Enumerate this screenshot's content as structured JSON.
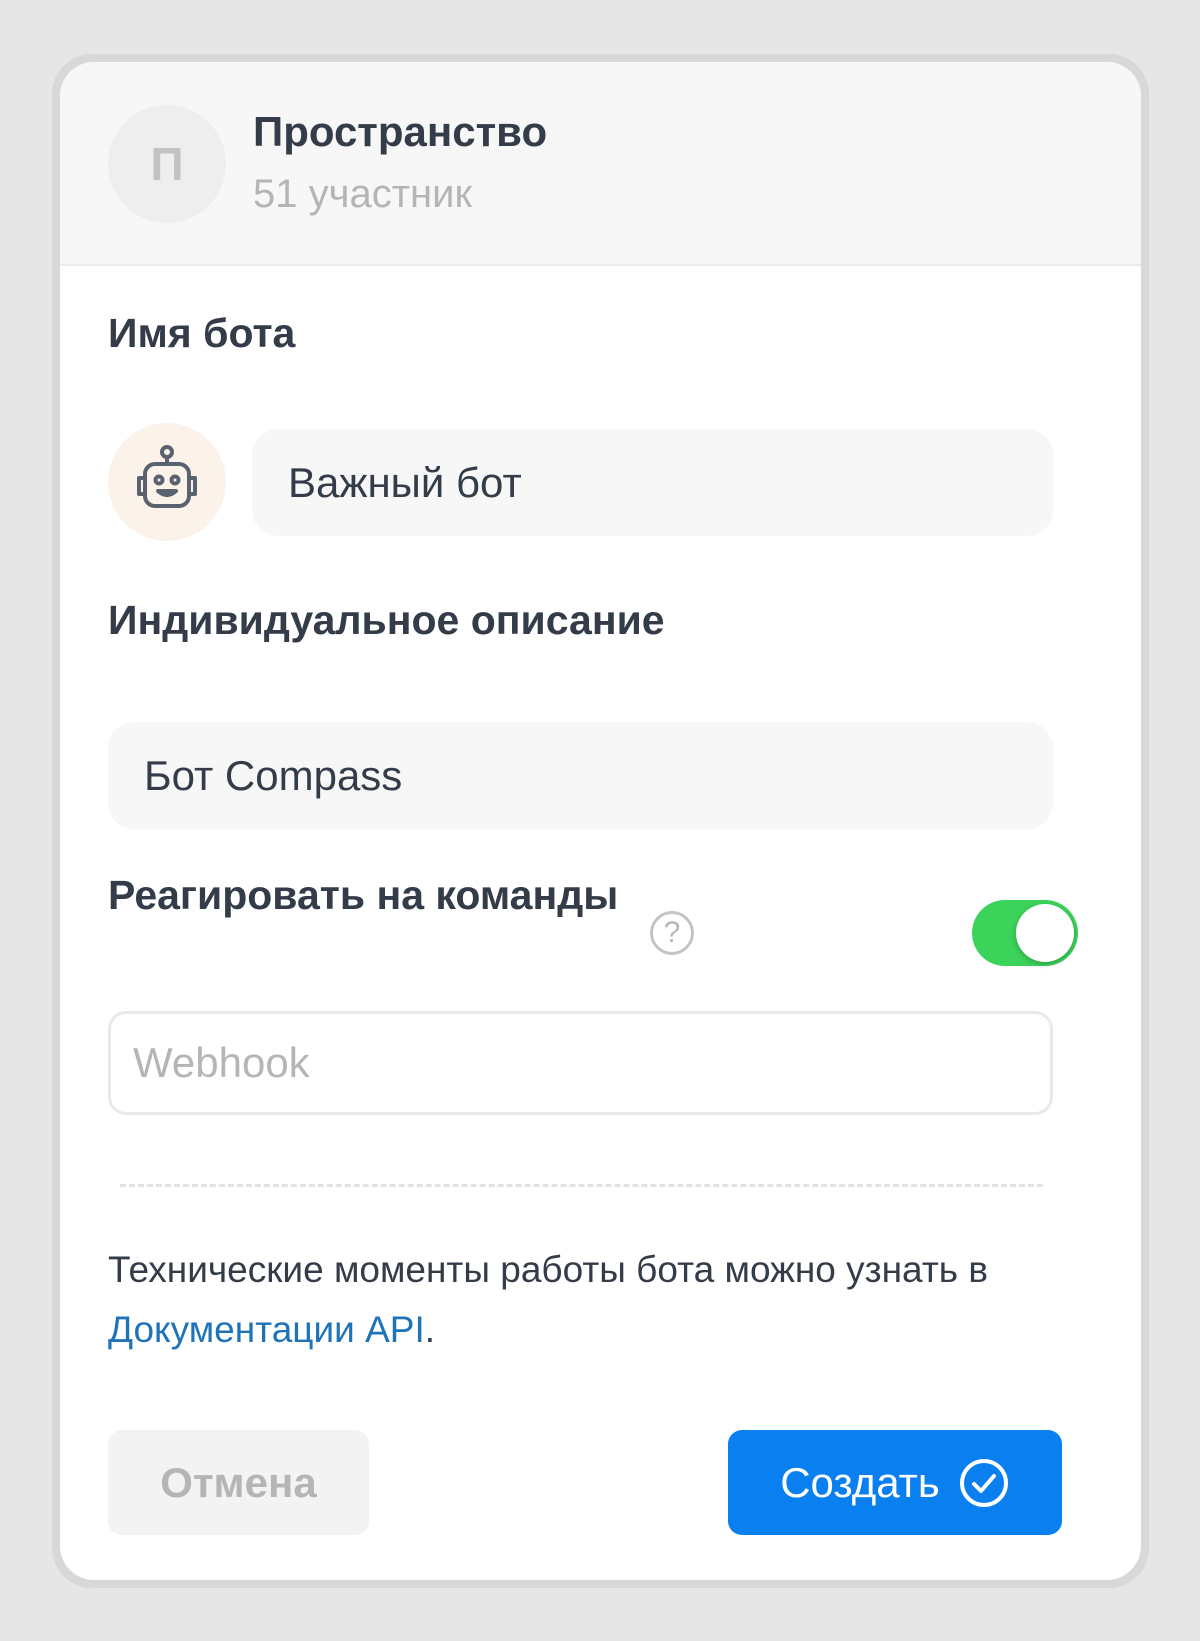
{
  "space": {
    "avatar_letter": "П",
    "title": "Пространство",
    "members": "51 участник"
  },
  "bot_name": {
    "label": "Имя бота",
    "value": "Важный бот",
    "avatar_icon": "robot-icon"
  },
  "description": {
    "label": "Индивидуальное описание",
    "value": "Бот Compass"
  },
  "commands": {
    "label": "Реагировать на команды",
    "help_icon": "question-circle-icon",
    "help_glyph": "?",
    "enabled": true,
    "toggle_color": "#3bd35a"
  },
  "webhook": {
    "placeholder": "Webhook",
    "value": ""
  },
  "note": {
    "text_before": "Технические моменты работы бота можно узнать в ",
    "link_text": "Документации API",
    "text_after": ".",
    "link_color": "#1f73b8"
  },
  "actions": {
    "cancel_label": "Отмена",
    "create_label": "Создать",
    "create_icon": "check-circle-icon",
    "create_color": "#0a80f0"
  }
}
